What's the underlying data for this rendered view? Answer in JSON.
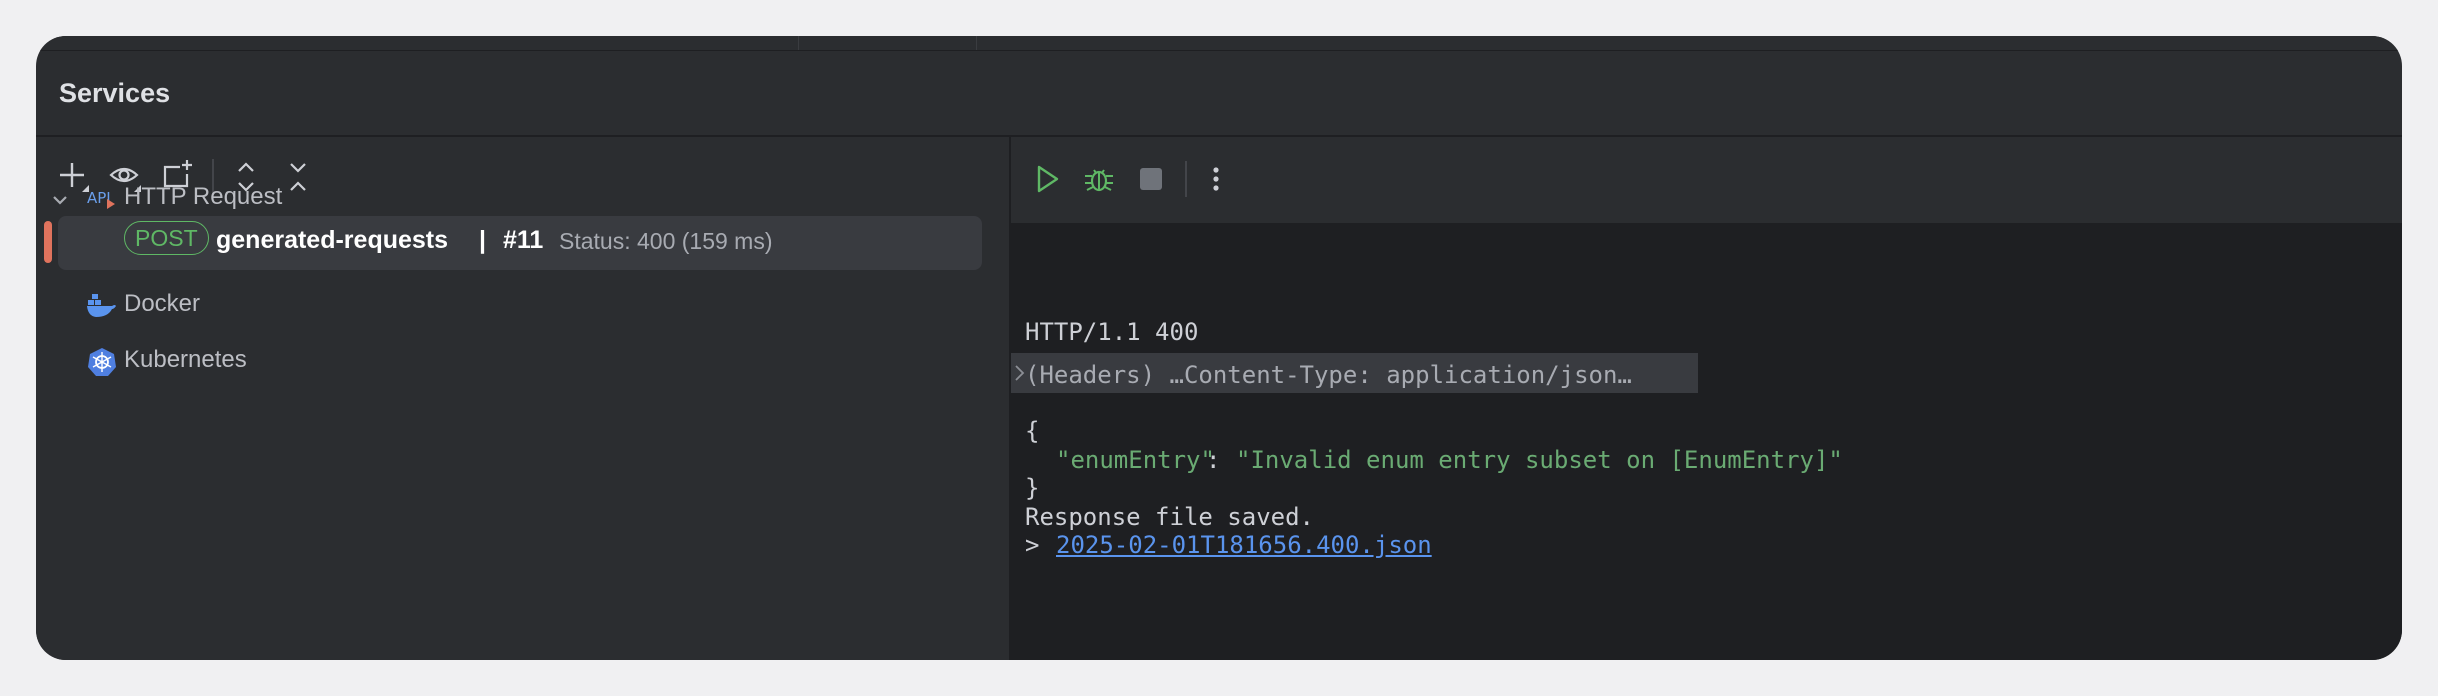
{
  "window": {
    "title": "Services"
  },
  "left_toolbar": {
    "buttons": [
      {
        "name": "add-service-button",
        "icon": "plus-icon"
      },
      {
        "name": "view-options-button",
        "icon": "eye-icon"
      },
      {
        "name": "new-group-button",
        "icon": "new-group-icon"
      },
      {
        "name": "expand-all-button",
        "icon": "expand-icon"
      },
      {
        "name": "collapse-all-button",
        "icon": "collapse-icon"
      }
    ]
  },
  "tree": {
    "http_request": {
      "label": "HTTP Request",
      "icon": "api-icon",
      "expanded": true
    },
    "request_item": {
      "method": "POST",
      "name": "generated-requests",
      "separator": "|",
      "number": "#11",
      "status": "Status: 400 (159 ms)"
    },
    "docker": {
      "label": "Docker",
      "icon": "docker-icon"
    },
    "kubernetes": {
      "label": "Kubernetes",
      "icon": "kubernetes-icon"
    }
  },
  "right_toolbar": {
    "buttons": [
      {
        "name": "run-button",
        "icon": "play-icon",
        "color": "#5fb865"
      },
      {
        "name": "debug-button",
        "icon": "bug-icon",
        "color": "#5fb865"
      },
      {
        "name": "stop-button",
        "icon": "stop-icon",
        "color": "#6f737a"
      },
      {
        "name": "more-button",
        "icon": "more-vertical-icon"
      }
    ]
  },
  "response": {
    "status_line": "HTTP/1.1 400",
    "headers_collapsed": "(Headers) …Content-Type: application/json…",
    "open_brace": "{",
    "json_key": "\"enumEntry\"",
    "json_colon": ": ",
    "json_value": "\"Invalid enum entry subset on [EnumEntry]\"",
    "close_brace": "}",
    "saved_text": "Response file saved.",
    "file_prefix": "> ",
    "file_link": "2025-02-01T181656.400.json"
  },
  "colors": {
    "accent_green": "#5fb865",
    "json_string": "#6aab73",
    "link": "#5a94ee",
    "selection_marker": "#e0735d"
  }
}
